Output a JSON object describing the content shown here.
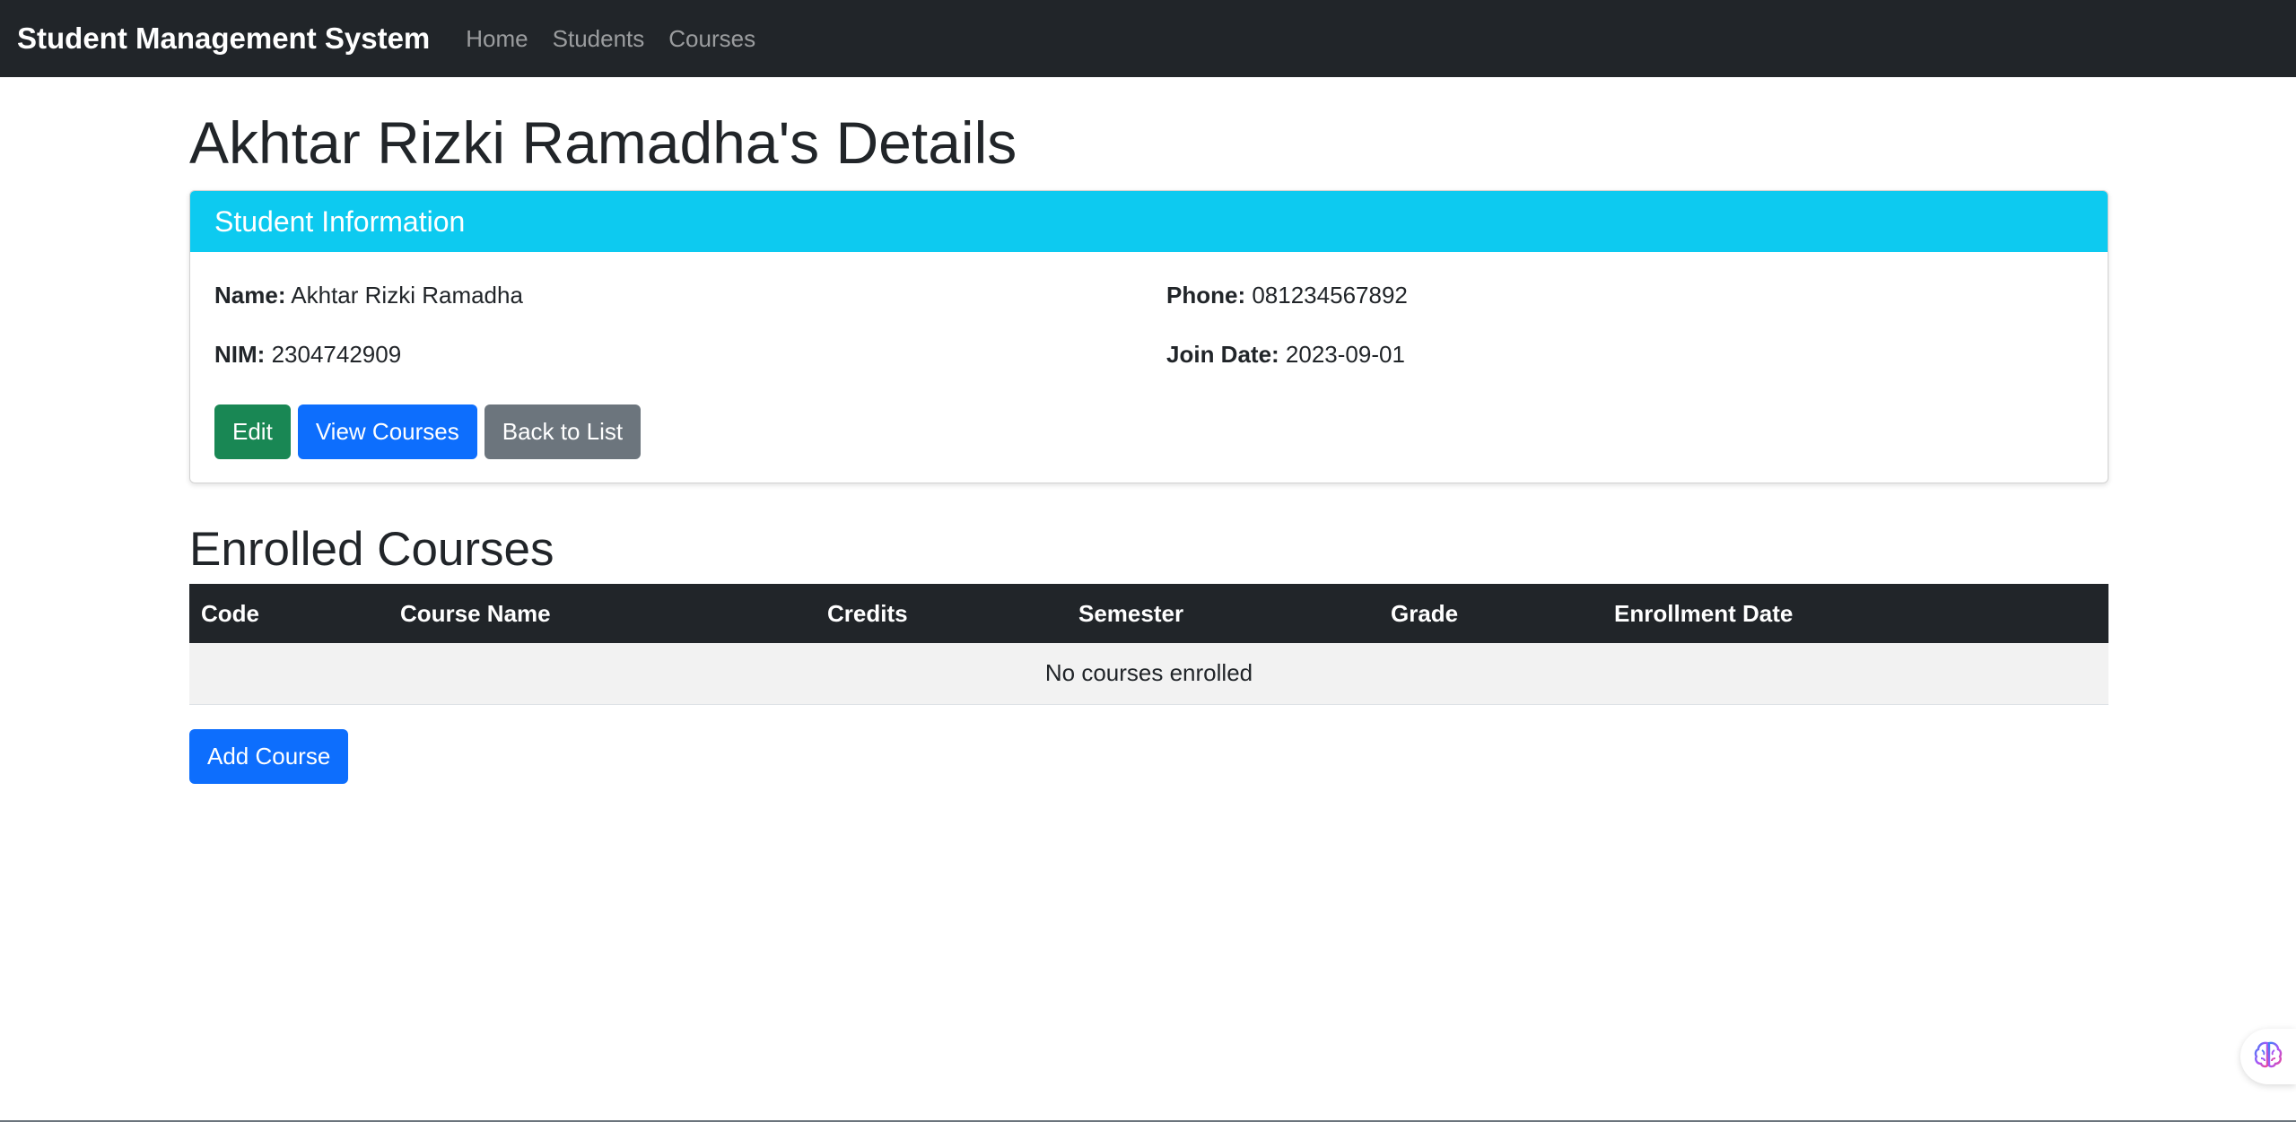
{
  "navbar": {
    "brand": "Student Management System",
    "links": [
      "Home",
      "Students",
      "Courses"
    ]
  },
  "page": {
    "title": "Akhtar Rizki Ramadha's Details"
  },
  "card": {
    "header": "Student Information",
    "fields": {
      "name_label": "Name:",
      "name_value": "Akhtar Rizki Ramadha",
      "nim_label": "NIM:",
      "nim_value": "2304742909",
      "phone_label": "Phone:",
      "phone_value": "081234567892",
      "join_label": "Join Date:",
      "join_value": "2023-09-01"
    },
    "buttons": {
      "edit": "Edit",
      "view_courses": "View Courses",
      "back": "Back to List"
    }
  },
  "enrolled": {
    "title": "Enrolled Courses",
    "columns": [
      "Code",
      "Course Name",
      "Credits",
      "Semester",
      "Grade",
      "Enrollment Date"
    ],
    "empty_message": "No courses enrolled",
    "add_button": "Add Course"
  },
  "colors": {
    "navbar": "#212529",
    "card_header": "#0dcaf0",
    "success": "#198754",
    "primary": "#0d6efd",
    "secondary": "#6c757d"
  },
  "floating_icon": "brain-icon"
}
